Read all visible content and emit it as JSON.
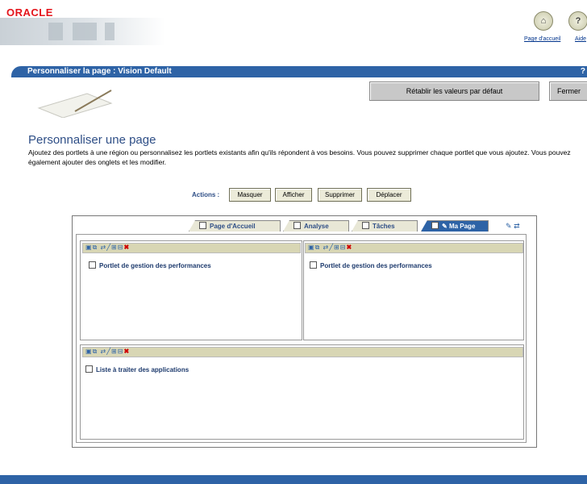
{
  "header": {
    "logo_text": "ORACLE",
    "home_link": "Page d'accueil",
    "help_link": "Aide",
    "home_icon": "home-icon",
    "help_icon_glyph": "?"
  },
  "titlebar": {
    "title": "Personnaliser la page : Vision Default",
    "help": "?"
  },
  "buttons": {
    "reset": "Rétablir les valeurs par défaut",
    "close": "Fermer"
  },
  "section": {
    "heading": "Personnaliser une page",
    "description": "Ajoutez des portlets à une région ou personnalisez les portlets existants afin qu'ils répondent à vos besoins. Vous pouvez supprimer chaque portlet que vous ajoutez. Vous pouvez également ajouter des onglets et les modifier."
  },
  "actions": {
    "label": "Actions :",
    "hide": "Masquer",
    "show": "Afficher",
    "delete": "Supprimer",
    "move": "Déplacer"
  },
  "tabs": [
    {
      "label": "Page d'Accueil"
    },
    {
      "label": "Analyse"
    },
    {
      "label": "Tâches"
    },
    {
      "label": "Ma Page",
      "active": true
    }
  ],
  "regions": {
    "top_left": {
      "portlet": "Portlet de gestion des performances"
    },
    "top_right": {
      "portlet": "Portlet de gestion des performances"
    },
    "bottom": {
      "portlet": "Liste à traiter des applications"
    }
  },
  "colors": {
    "brand_red": "#e4141b",
    "title_blue": "#2e63a6",
    "portlet_bar": "#d8d6b4"
  }
}
